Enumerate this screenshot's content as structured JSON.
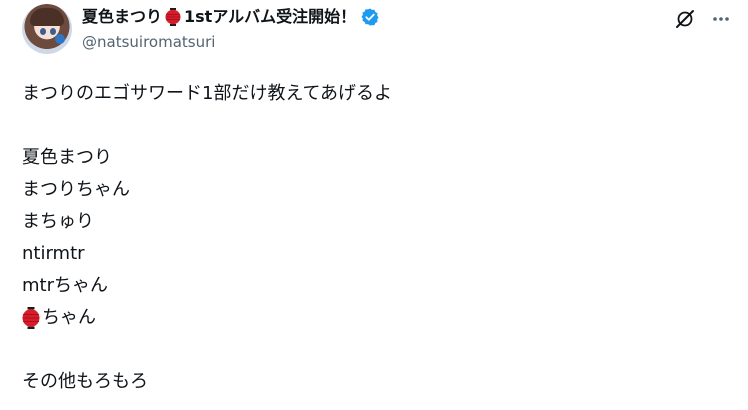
{
  "author": {
    "display_name_prefix": "夏色まつり",
    "display_name_suffix": "1stアルバム受注開始！",
    "handle": "@natsuiromatsuri",
    "verified_icon": "verified-badge-icon",
    "avatar": "avatar-image"
  },
  "actions": {
    "grok_icon": "grok-icon",
    "more_icon": "more-icon"
  },
  "tweet": {
    "lines": [
      "まつりのエゴサワード1部だけ教えてあげるよ",
      "",
      "夏色まつり",
      "まつりちゃん",
      "まちゅり",
      "ntirmtr",
      "mtrちゃん",
      "ちゃん",
      "",
      "その他もろもろ"
    ]
  },
  "colors": {
    "text": "#0f1419",
    "secondary": "#536471",
    "verified": "#1d9bf0",
    "lantern": "#d91c2a"
  }
}
